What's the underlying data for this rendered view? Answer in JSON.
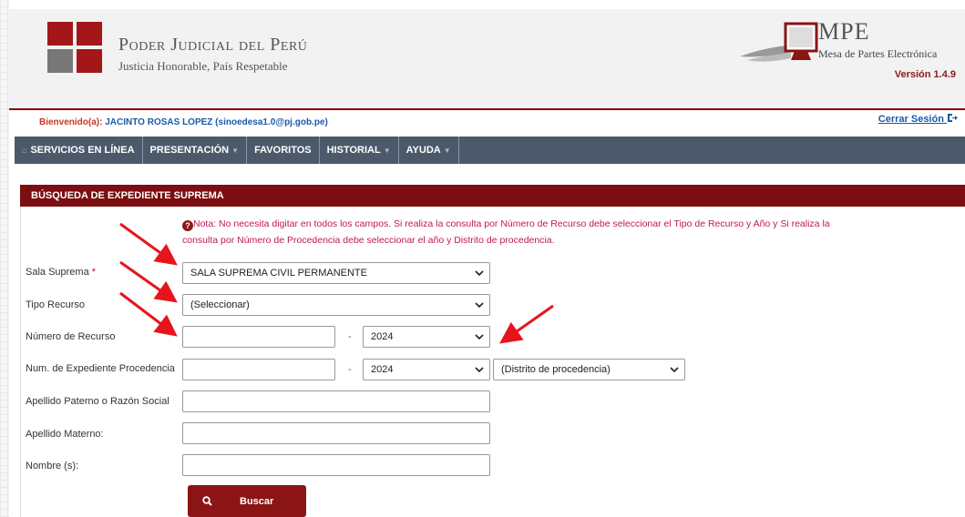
{
  "header": {
    "brand_title": "Poder Judicial del Perú",
    "brand_subtitle": "Justicia Honorable, País Respetable",
    "mpe_title": "MPE",
    "mpe_subtitle": "Mesa de Partes Electrónica",
    "version": "Versión 1.4.9"
  },
  "user": {
    "welcome_label": "Bienvenido(a):",
    "welcome_user": "JACINTO ROSAS LOPEZ (sinoedesa1.0@pj.gob.pe)",
    "logout": "Cerrar Sesión"
  },
  "nav": {
    "items": [
      {
        "label": "SERVICIOS EN LÍNEA",
        "icon": "home-icon",
        "caret": false
      },
      {
        "label": "PRESENTACIÓN",
        "caret": true
      },
      {
        "label": "FAVORITOS",
        "caret": false
      },
      {
        "label": "HISTORIAL",
        "caret": true
      },
      {
        "label": "AYUDA",
        "caret": true
      }
    ]
  },
  "panel": {
    "title": "BÚSQUEDA DE EXPEDIENTE SUPREMA",
    "note": "Nota: No necesita digitar en todos los campos. Si realiza la consulta por Número de Recurso debe seleccionar el Tipo de Recurso y Año y Si realiza la consulta por Número de Procedencia debe seleccionar el año y Distrito de procedencia."
  },
  "form": {
    "sala_label": "Sala Suprema",
    "sala_required": "*",
    "sala_value": "SALA SUPREMA CIVIL PERMANENTE",
    "tipo_label": "Tipo Recurso",
    "tipo_value": "(Seleccionar)",
    "numero_label": "Número de Recurso",
    "numero_value": "",
    "numero_dash": "-",
    "numero_year": "2024",
    "proc_label": "Num. de Expediente Procedencia",
    "proc_value": "",
    "proc_dash": "-",
    "proc_year": "2024",
    "proc_distrito": "(Distrito de procedencia)",
    "ap_paterno_label": "Apellido Paterno o Razón Social",
    "ap_materno_label": "Apellido Materno:",
    "nombre_label": "Nombre (s):",
    "search_button": "Buscar"
  },
  "colors": {
    "brand_red": "#8b1414",
    "nav_bg": "#4b596b",
    "note_color": "#c0175a",
    "annotation_arrow": "#e8141c"
  }
}
